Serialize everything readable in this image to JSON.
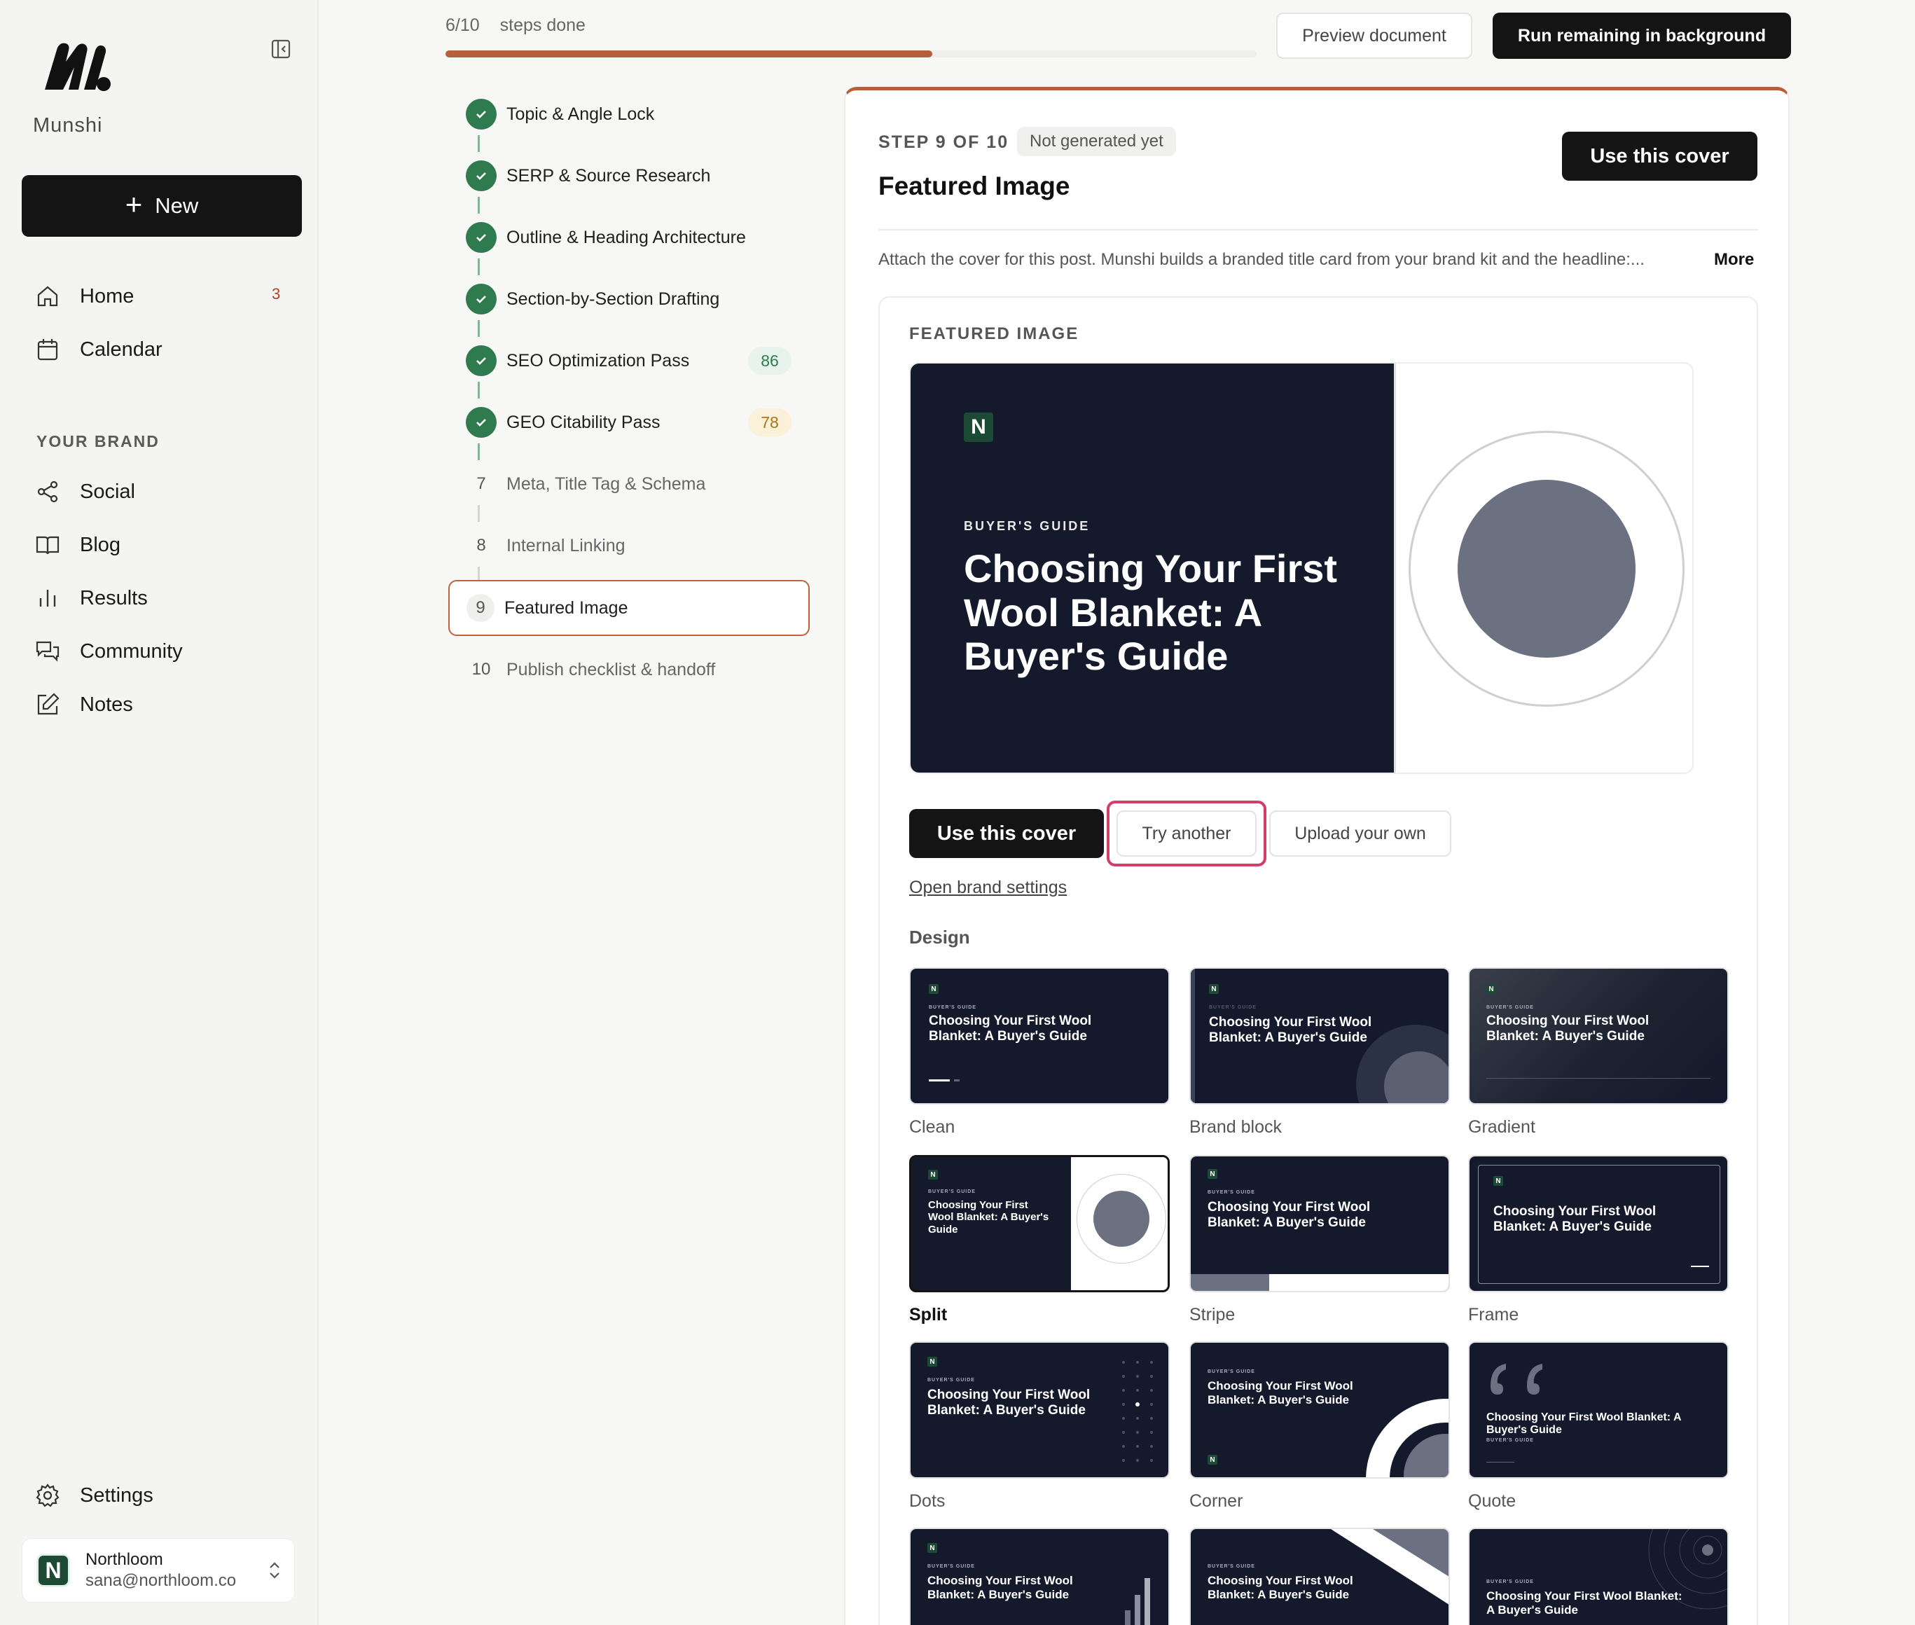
{
  "sidebar": {
    "brand_name": "Munshi",
    "new_label": "New",
    "nav": [
      {
        "label": "Home",
        "badge": "3"
      },
      {
        "label": "Calendar"
      }
    ],
    "section_label": "YOUR BRAND",
    "brand_nav": [
      {
        "label": "Social"
      },
      {
        "label": "Blog"
      },
      {
        "label": "Results"
      },
      {
        "label": "Community"
      },
      {
        "label": "Notes"
      }
    ],
    "settings_label": "Settings",
    "account": {
      "initial": "N",
      "name": "Northloom",
      "email": "sana@northloom.co"
    }
  },
  "topbar": {
    "progress_count": "6/10",
    "progress_label": "steps done",
    "progress_fraction": 0.6,
    "preview_label": "Preview document",
    "run_label": "Run remaining in background"
  },
  "steps": [
    {
      "label": "Topic & Angle Lock",
      "done": true
    },
    {
      "label": "SERP & Source Research",
      "done": true
    },
    {
      "label": "Outline & Heading Architecture",
      "done": true
    },
    {
      "label": "Section-by-Section Drafting",
      "done": true
    },
    {
      "label": "SEO Optimization Pass",
      "done": true,
      "score": "86"
    },
    {
      "label": "GEO Citability Pass",
      "done": true,
      "score": "78"
    },
    {
      "num": "7",
      "label": "Meta, Title Tag & Schema"
    },
    {
      "num": "8",
      "label": "Internal Linking"
    },
    {
      "num": "9",
      "label": "Featured Image",
      "active": true
    },
    {
      "num": "10",
      "label": "Publish checklist & handoff"
    }
  ],
  "panel": {
    "step_tag": "STEP 9 OF 10",
    "status": "Not generated yet",
    "title": "Featured Image",
    "use_cover_label": "Use this cover",
    "description": "Attach the cover for this post. Munshi builds a branded title card from your brand kit and the headline:...",
    "more_label": "More",
    "card_label": "FEATURED IMAGE",
    "hero": {
      "logo": "N",
      "kicker": "BUYER'S GUIDE",
      "title": "Choosing Your First Wool Blanket: A Buyer's Guide"
    },
    "actions": {
      "use": "Use this cover",
      "try": "Try another",
      "upload": "Upload your own"
    },
    "brand_link": "Open brand settings",
    "design_label": "Design",
    "thumb_title": "Choosing Your First Wool Blanket: A Buyer's Guide",
    "thumb_kicker": "BUYER'S GUIDE",
    "thumb_logo": "N",
    "designs": [
      "Clean",
      "Brand block",
      "Gradient",
      "Split",
      "Stripe",
      "Frame",
      "Dots",
      "Corner",
      "Quote"
    ],
    "selected_design": "Split"
  },
  "colors": {
    "accent": "#b5603a",
    "dark": "#141414",
    "navy": "#141a2b",
    "success": "#2f7a4f",
    "highlight": "#d33d68"
  }
}
